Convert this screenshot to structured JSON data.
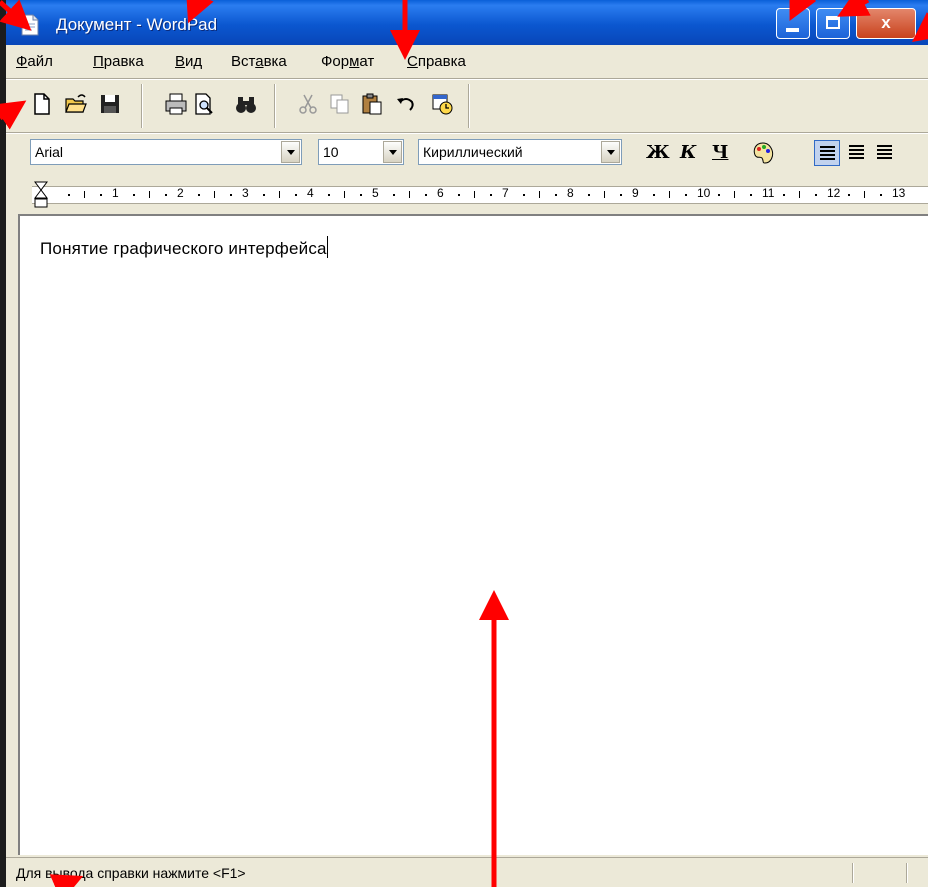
{
  "window": {
    "title": "Документ - WordPad",
    "close_glyph": "x"
  },
  "menu": [
    {
      "pre": "",
      "key": "Ф",
      "post": "айл"
    },
    {
      "pre": "",
      "key": "П",
      "post": "равка"
    },
    {
      "pre": "",
      "key": "В",
      "post": "ид"
    },
    {
      "pre": "Вст",
      "key": "а",
      "post": "вка"
    },
    {
      "pre": "Фор",
      "key": "м",
      "post": "ат"
    },
    {
      "pre": "",
      "key": "С",
      "post": "правка"
    }
  ],
  "toolbar": {
    "icons": [
      "new-document-icon",
      "open-folder-icon",
      "save-disk-icon",
      "print-icon",
      "print-preview-icon",
      "find-binoculars-icon",
      "cut-scissors-icon",
      "copy-icon",
      "paste-icon",
      "undo-icon",
      "date-time-icon"
    ]
  },
  "format": {
    "font_name": "Arial",
    "font_size": "10",
    "script": "Кириллический",
    "bold_label": "Ж",
    "italic_label": "К",
    "underline_label": "Ч"
  },
  "ruler": {
    "numbers": [
      "1",
      "2",
      "3",
      "4",
      "5",
      "6",
      "7",
      "8",
      "9",
      "10",
      "11",
      "12",
      "13"
    ]
  },
  "document": {
    "text": "Понятие графического интерфейса"
  },
  "status": {
    "text": "Для вывода справки нажмите <F1>"
  },
  "colors": {
    "title_bar": "#0b57d0",
    "annotation_arrow": "#ff0000",
    "chrome": "#ece9d8"
  }
}
